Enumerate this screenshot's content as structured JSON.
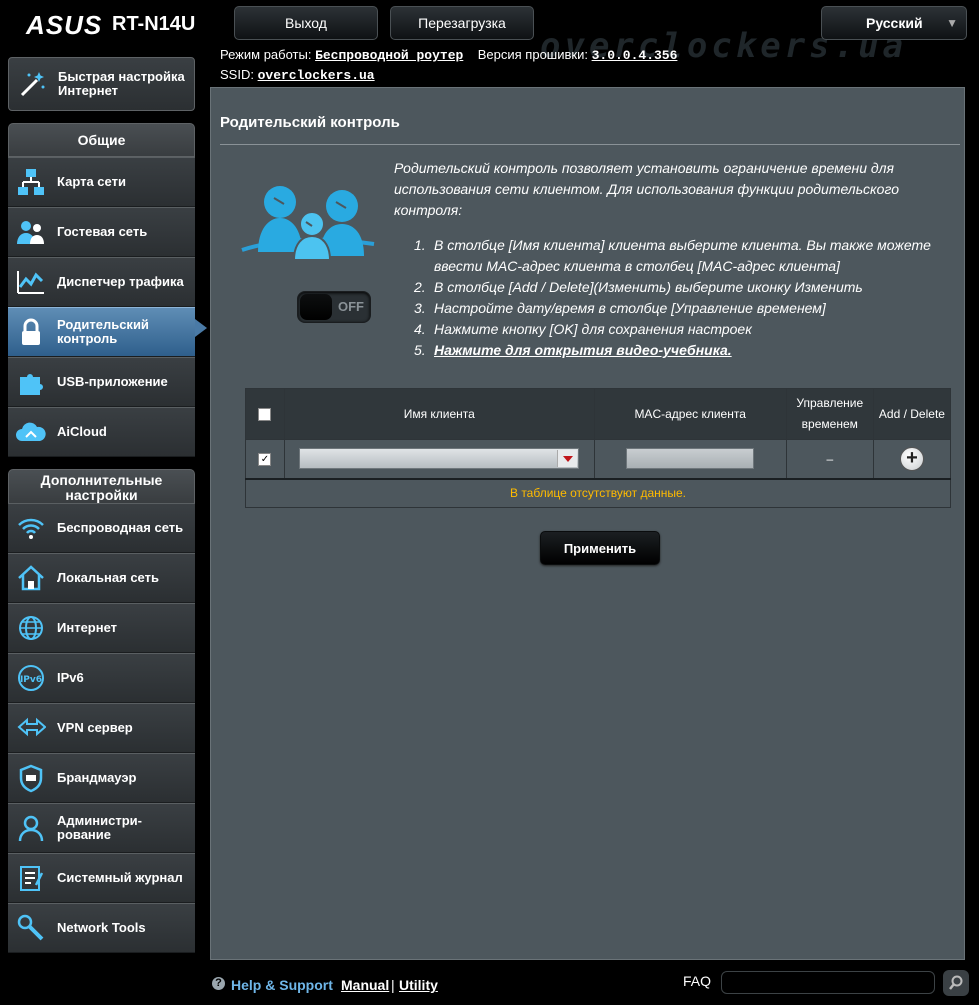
{
  "header": {
    "brand": "ASUS",
    "model": "RT-N14U",
    "logout_label": "Выход",
    "reboot_label": "Перезагрузка",
    "language": "Русский",
    "watermark": "overclockers.ua"
  },
  "status": {
    "mode_label": "Режим работы:",
    "mode_value": "Беспроводной роутер",
    "firmware_label": "Версия прошивки:",
    "firmware_value": "3.0.0.4.356",
    "ssid_label": "SSID:",
    "ssid_value": "overclockers.ua"
  },
  "sidebar": {
    "quick_setup": "Быстрая настройка Интернет",
    "general_header": "Общие",
    "general_items": [
      {
        "label": "Карта сети",
        "icon": "network-map-icon"
      },
      {
        "label": "Гостевая сеть",
        "icon": "guest-network-icon"
      },
      {
        "label": "Диспетчер трафика",
        "icon": "traffic-manager-icon"
      },
      {
        "label": "Родительский контроль",
        "icon": "lock-icon",
        "active": true
      },
      {
        "label": "USB-приложение",
        "icon": "puzzle-icon"
      },
      {
        "label": "AiCloud",
        "icon": "cloud-icon"
      }
    ],
    "advanced_header": "Дополнительные настройки",
    "advanced_items": [
      {
        "label": "Беспроводная сеть",
        "icon": "wifi-icon"
      },
      {
        "label": "Локальная сеть",
        "icon": "home-icon"
      },
      {
        "label": "Интернет",
        "icon": "globe-icon"
      },
      {
        "label": "IPv6",
        "icon": "ipv6-icon"
      },
      {
        "label": "VPN сервер",
        "icon": "vpn-icon"
      },
      {
        "label": "Брандмауэр",
        "icon": "shield-icon"
      },
      {
        "label": "Администри-рование",
        "icon": "admin-icon"
      },
      {
        "label": "Системный журнал",
        "icon": "log-icon"
      },
      {
        "label": "Network Tools",
        "icon": "tools-icon"
      }
    ]
  },
  "main": {
    "title": "Родительский контроль",
    "description": "Родительский контроль позволяет установить ограничение времени для использования сети клиентом. Для использования функции родительского контроля:",
    "steps": [
      "В столбце [Имя клиента] клиента выберите клиента. Вы также можете ввести MAC-адрес клиента в столбец [MAC-адрес клиента]",
      "В столбце [Add / Delete](Изменить) выберите иконку Изменить",
      "Настройте дату/время в столбце [Управление временем]",
      "Нажмите кнопку [OK] для сохранения настроек",
      "Нажмите для открытия видео-учебника."
    ],
    "toggle_label": "OFF",
    "table": {
      "headers": [
        "",
        "Имя клиента",
        "MAC-адрес клиента",
        "Управление временем",
        "Add / Delete"
      ],
      "header_checked": false,
      "row_checked": true,
      "client_value": "",
      "mac_value": "",
      "time_control": "–",
      "empty_text": "В таблице отсутствуют данные."
    },
    "apply_label": "Применить"
  },
  "footer": {
    "help": "Help & Support",
    "manual": "Manual",
    "separator": "|",
    "utility": "Utility",
    "faq": "FAQ"
  },
  "colors": {
    "background": "#000000",
    "panel": "#4d575d",
    "active_nav": "#3f6f9c",
    "empty_text": "#ffbb00",
    "help_link": "#6fb6e8"
  }
}
